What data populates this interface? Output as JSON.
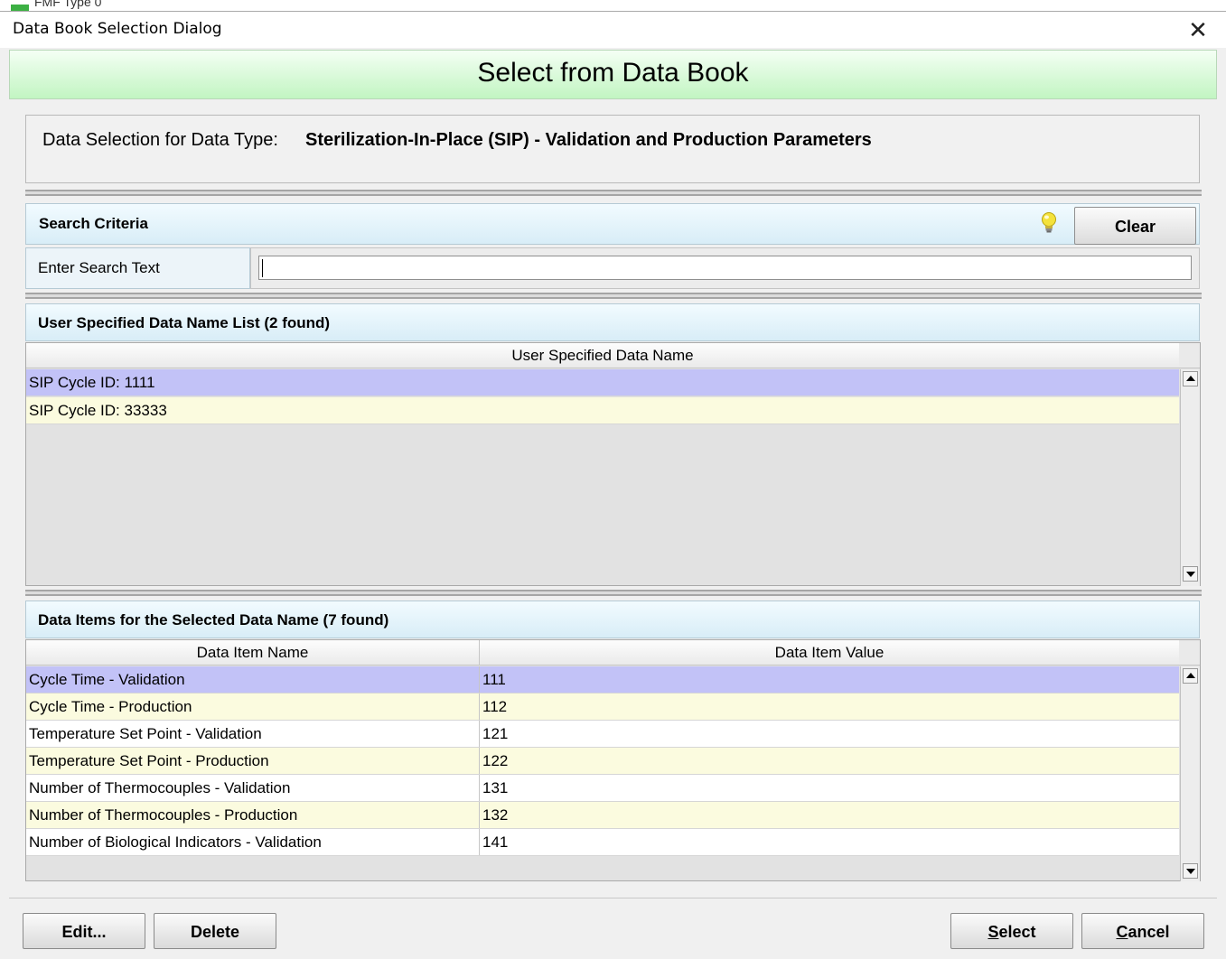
{
  "background_fragment": "FMF Type 0",
  "window": {
    "title": "Data Book Selection Dialog",
    "close_glyph": "✕"
  },
  "banner": {
    "title": "Select from Data Book"
  },
  "data_type": {
    "label": "Data Selection for Data Type:",
    "value": "Sterilization-In-Place (SIP) - Validation and Production Parameters"
  },
  "search": {
    "title": "Search Criteria",
    "hint_icon": "lightbulb-icon",
    "clear_label": "Clear",
    "field_label": "Enter Search Text",
    "value": "",
    "placeholder": ""
  },
  "name_list": {
    "title": "User Specified Data Name List  (2 found)",
    "column": "User Specified Data Name",
    "rows": [
      "SIP Cycle ID: 1111",
      "SIP Cycle ID: 33333"
    ]
  },
  "items": {
    "title": "Data Items for the Selected Data Name  (7 found)",
    "columns": [
      "Data Item Name",
      "Data Item Value"
    ],
    "rows": [
      [
        "Cycle Time - Validation",
        "111"
      ],
      [
        "Cycle Time - Production",
        "112"
      ],
      [
        "Temperature Set Point - Validation",
        "121"
      ],
      [
        "Temperature Set Point - Production",
        "122"
      ],
      [
        "Number of Thermocouples - Validation",
        "131"
      ],
      [
        "Number of Thermocouples - Production",
        "132"
      ],
      [
        "Number of Biological Indicators - Validation",
        "141"
      ]
    ]
  },
  "footer": {
    "edit": "Edit...",
    "delete": "Delete",
    "select_mnemonic": "S",
    "select_rest": "elect",
    "cancel_mnemonic": "C",
    "cancel_rest": "ancel"
  },
  "colors": {
    "selected_row": "#c2c2f7",
    "alt_row": "#fbfbdf",
    "banner_green": "#c2f5c2",
    "section_blue": "#d8edf7"
  }
}
